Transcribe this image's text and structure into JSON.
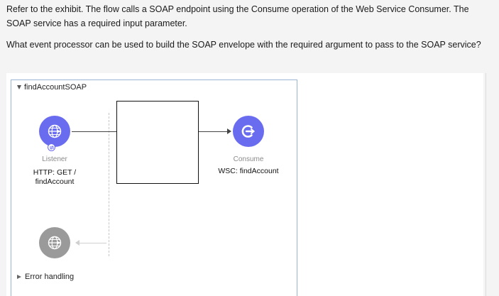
{
  "question": {
    "paragraph1": "Refer to the exhibit. The flow calls a SOAP endpoint using the Consume operation of the Web Service Consumer. The SOAP service has a required input parameter.",
    "paragraph2": "What event processor can be used to build the SOAP envelope with the required argument to pass to the SOAP service?"
  },
  "exhibit": {
    "flow_name": "findAccountSOAP",
    "listener": {
      "type": "Listener",
      "label": "HTTP: GET / findAccount",
      "icon": "globe-icon"
    },
    "consume": {
      "type": "Consume",
      "label": "WSC: findAccount",
      "icon": "consume-icon"
    },
    "error_handler": {
      "icon": "globe-icon"
    },
    "error_handling_label": "Error handling",
    "colors": {
      "connector_blue": "#6a6cf0",
      "error_gray": "#9a9a9a",
      "flow_border": "#9ab4d3"
    }
  }
}
